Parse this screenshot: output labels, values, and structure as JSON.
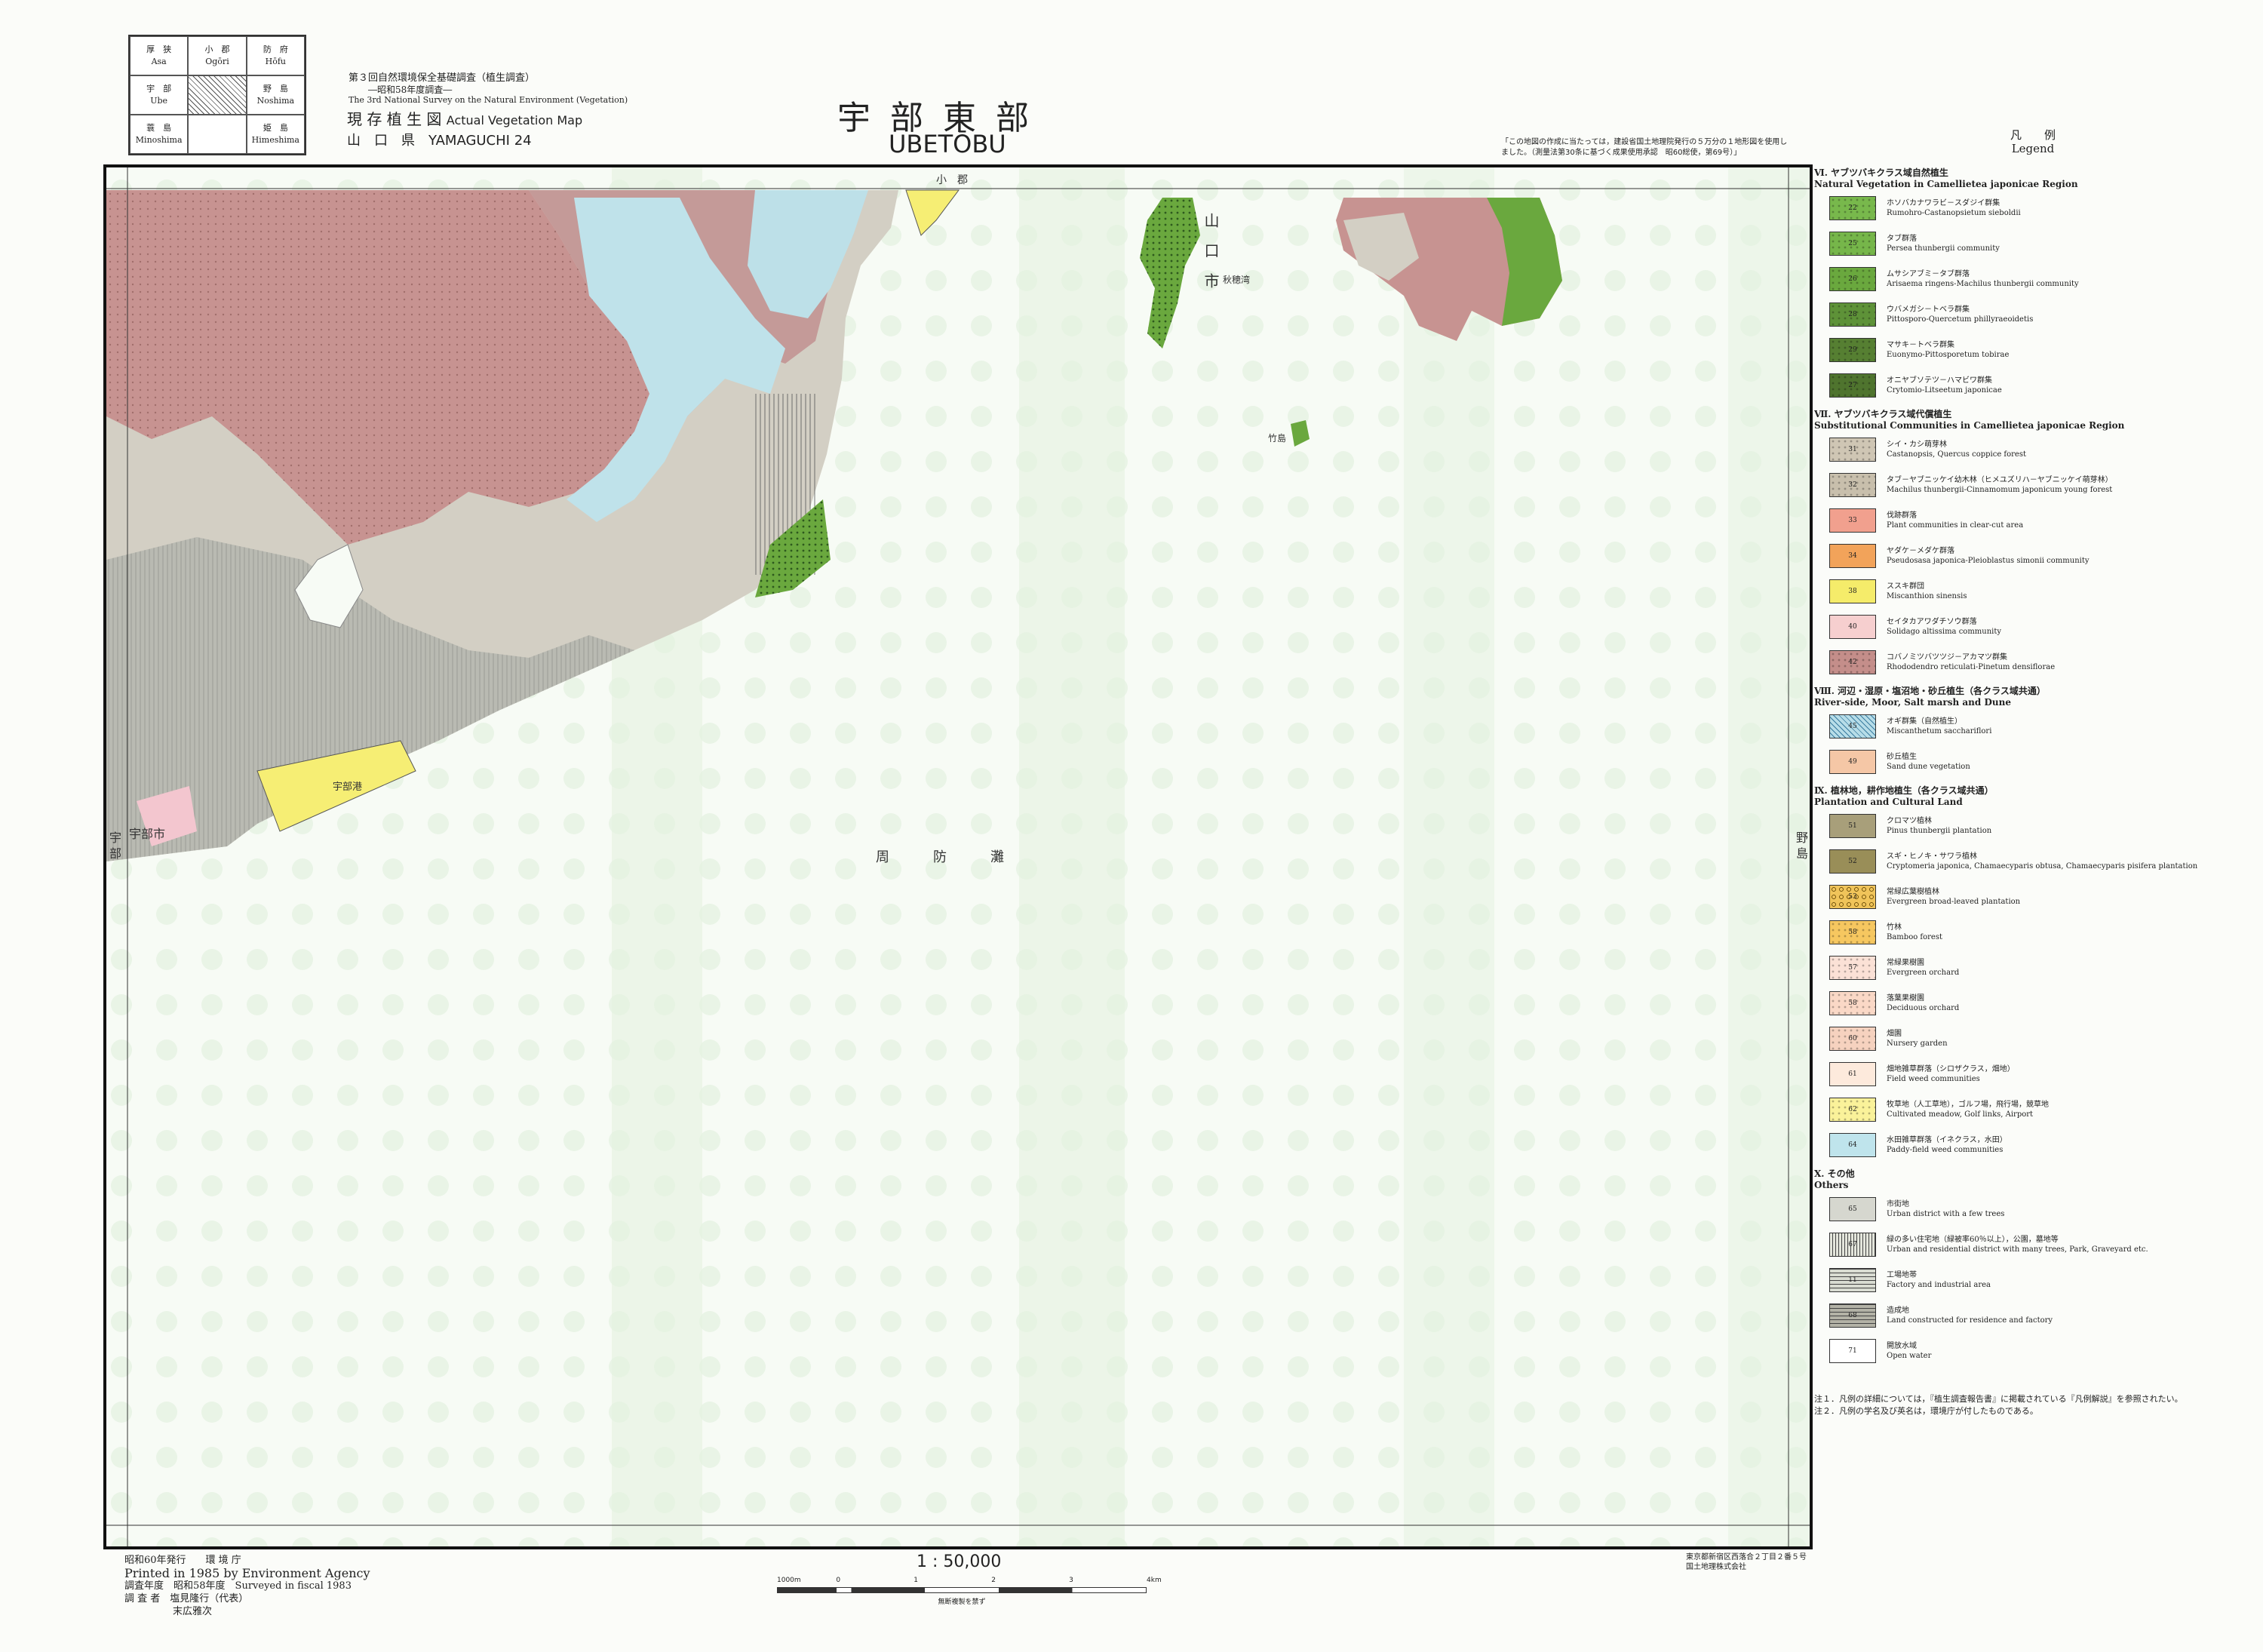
{
  "index_map": [
    {
      "ja": "厚　狭",
      "en": "Asa"
    },
    {
      "ja": "小　郡",
      "en": "Ogōri"
    },
    {
      "ja": "防　府",
      "en": "Hōfu"
    },
    {
      "ja": "宇　部",
      "en": "Ube"
    },
    {
      "ja": "",
      "en": ""
    },
    {
      "ja": "野　島",
      "en": "Noshima"
    },
    {
      "ja": "蓑　島",
      "en": "Minoshima"
    },
    {
      "ja": "",
      "en": ""
    },
    {
      "ja": "姫　島",
      "en": "Himeshima"
    }
  ],
  "survey": {
    "line1": "第３回自然環境保全基礎調査（植生調査）",
    "line2": "―昭和58年度調査―",
    "line3": "The 3rd National Survey on the Natural Environment (Vegetation)",
    "map_type_ja": "現 存 植 生 図",
    "map_type_en": "Actual Vegetation Map",
    "pref": "山　口　県　YAMAGUCHI 24"
  },
  "title": {
    "ja": "宇 部 東 部",
    "en": "UBETŌBU"
  },
  "top_note": "「この地図の作成に当たっては，建設省国土地理院発行の５万分の１地形図を使用しました。（測量法第30条に基づく成果使用承認　昭60総使，第69号）」",
  "map_labels": {
    "ogori": "小　郡",
    "yamaguchi": "山　口　市",
    "ube_city": "宇部市",
    "ube_v": "宇 部",
    "noshima_v": "野 島",
    "suonada": "周　防　灘",
    "takeshima": "竹島",
    "port": "宇部港",
    "aio": "秋穂湾"
  },
  "legend": {
    "title_ja": "凡　　例",
    "title_en": "Legend",
    "sections": [
      {
        "heading": "Ⅵ. ヤブツバキクラス域自然植生\nNatural Vegetation in Camellietea japonicae Region",
        "items": [
          {
            "code": "22",
            "ja": "ホソバカナワラビ－スダジイ群集",
            "en": "Rumohro-Castanopsietum sieboldii",
            "color": "#78b84c",
            "pattern": "dots"
          },
          {
            "code": "25",
            "ja": "タブ群落",
            "en": "Persea thunbergii community",
            "color": "#76b64a",
            "pattern": "dots"
          },
          {
            "code": "26",
            "ja": "ムサシアブミ－タブ群落",
            "en": "Arisaema ringens-Machilus thunbergii community",
            "color": "#6aa83e",
            "pattern": "dots"
          },
          {
            "code": "28",
            "ja": "ウバメガシ－トベラ群集",
            "en": "Pittosporo-Quercetum phillyraeoidetis",
            "color": "#5e9238",
            "pattern": "dots"
          },
          {
            "code": "29",
            "ja": "マサキ－トベラ群集",
            "en": "Euonymo-Pittosporetum tobirae",
            "color": "#567f32",
            "pattern": "dots"
          },
          {
            "code": "27",
            "ja": "オニヤブソテツ－ハマビワ群集",
            "en": "Crytomio-Litseetum japonicae",
            "color": "#4f742e",
            "pattern": "dots"
          }
        ]
      },
      {
        "heading": "Ⅶ. ヤブツバキクラス域代償植生\nSubstitutional Communities in Camellietea japonicae Region",
        "items": [
          {
            "code": "31",
            "ja": "シイ・カシ萌芽林",
            "en": "Castanopsis, Quercus coppice forest",
            "color": "#cfc6b4",
            "pattern": "dots"
          },
          {
            "code": "32",
            "ja": "タブ－ヤブニッケイ幼木林（ヒメユズリハ－ヤブニッケイ萌芽林）",
            "en": "Machilus thunbergii-Cinnamomum japonicum young forest",
            "color": "#c8bfac",
            "pattern": "dots"
          },
          {
            "code": "33",
            "ja": "伐跡群落",
            "en": "Plant communities in clear-cut area",
            "color": "#f1a08e",
            "pattern": "none"
          },
          {
            "code": "34",
            "ja": "ヤダケ－メダケ群落",
            "en": "Pseudosasa japonica-Pleioblastus simonii community",
            "color": "#f2a35a",
            "pattern": "none"
          },
          {
            "code": "38",
            "ja": "ススキ群団",
            "en": "Miscanthion sinensis",
            "color": "#f5ec6a",
            "pattern": "none"
          },
          {
            "code": "40",
            "ja": "セイタカアワダチソウ群落",
            "en": "Solidago altissima community",
            "color": "#f6cfcf",
            "pattern": "none"
          },
          {
            "code": "42",
            "ja": "コバノミツバツツジ－アカマツ群集",
            "en": "Rhododendro reticulati-Pinetum densiflorae",
            "color": "#c48e8a",
            "pattern": "dots"
          }
        ]
      },
      {
        "heading": "Ⅷ. 河辺・湿原・塩沼地・砂丘植生（各クラス域共通）\nRiver-side, Moor, Salt marsh and Dune",
        "items": [
          {
            "code": "45",
            "ja": "オギ群集（自然植生）",
            "en": "Miscanthetum sacchariflori",
            "color": "#b7dde8",
            "pattern": "hatch"
          },
          {
            "code": "49",
            "ja": "砂丘植生",
            "en": "Sand dune vegetation",
            "color": "#f5c7a6",
            "pattern": "none"
          }
        ]
      },
      {
        "heading": "Ⅸ. 植林地，耕作地植生（各クラス域共通）\nPlantation and Cultural Land",
        "items": [
          {
            "code": "51",
            "ja": "クロマツ植林",
            "en": "Pinus thunbergii plantation",
            "color": "#a89f7a",
            "pattern": "none"
          },
          {
            "code": "52",
            "ja": "スギ・ヒノキ・サワラ植林",
            "en": "Cryptomeria japonica, Chamaecyparis obtusa, Chamaecyparis pisifera plantation",
            "color": "#998e58",
            "pattern": "none"
          },
          {
            "code": "53",
            "ja": "常緑広葉樹植林",
            "en": "Evergreen broad-leaved plantation",
            "color": "#f0c45a",
            "pattern": "rings"
          },
          {
            "code": "58",
            "ja": "竹林",
            "en": "Bamboo forest",
            "color": "#f6c760",
            "pattern": "dots"
          },
          {
            "code": "57",
            "ja": "常緑果樹園",
            "en": "Evergreen orchard",
            "color": "#fbe1d6",
            "pattern": "dots"
          },
          {
            "code": "58",
            "ja": "落葉果樹園",
            "en": "Deciduous orchard",
            "color": "#fad8c6",
            "pattern": "dots"
          },
          {
            "code": "60",
            "ja": "畑園",
            "en": "Nursery garden",
            "color": "#f6d2bf",
            "pattern": "dots"
          },
          {
            "code": "61",
            "ja": "畑地雑草群落（シロザクラス，畑地）",
            "en": "Field weed communities",
            "color": "#fdeadc",
            "pattern": "none"
          },
          {
            "code": "62",
            "ja": "牧草地（人工草地），ゴルフ場，飛行場，競草地",
            "en": "Cultivated meadow, Golf links, Airport",
            "color": "#faf29a",
            "pattern": "dots"
          },
          {
            "code": "64",
            "ja": "水田雑草群落（イネクラス，水田）",
            "en": "Paddy-field weed communities",
            "color": "#bfe4ec",
            "pattern": "none"
          }
        ]
      },
      {
        "heading": "Ⅹ. その他\nOthers",
        "items": [
          {
            "code": "65",
            "ja": "市街地",
            "en": "Urban district with a few trees",
            "color": "#d6d7cf",
            "pattern": "none"
          },
          {
            "code": "67",
            "ja": "緑の多い住宅地（緑被率60％以上），公園，墓地等",
            "en": "Urban and residential district with many trees, Park, Graveyard etc.",
            "color": "#e4e6dc",
            "pattern": "vlines"
          },
          {
            "code": "11",
            "ja": "工場地帯",
            "en": "Factory and industrial area",
            "color": "#d9dcd2",
            "pattern": "hlines"
          },
          {
            "code": "68",
            "ja": "造成地",
            "en": "Land constructed for residence and factory",
            "color": "#b3b2a6",
            "pattern": "hlines"
          },
          {
            "code": "71",
            "ja": "開放水域",
            "en": "Open water",
            "color": "#ffffff",
            "pattern": "none"
          }
        ]
      }
    ],
    "notes": [
      "注１．凡例の詳細については，『植生調査報告書』に掲載されている『凡例解説』を参照されたい。",
      "注２．凡例の学名及び英名は，環境庁が付したものである。"
    ]
  },
  "bottom": {
    "issue_ja": "昭和60年発行　　環 境 庁",
    "printed": "Printed in 1985 by Environment Agency",
    "year": "調査年度　昭和58年度　Surveyed in fiscal 1983",
    "surveyor": "調 査 者　塩見隆行（代表）",
    "surveyor2": "末広雅次",
    "scale": "1 : 50,000",
    "scale_note": "無断複製を禁ず",
    "scale_marks": [
      "1000m",
      "0",
      "1",
      "2",
      "3",
      "4km"
    ],
    "publisher_addr": "東京都新宿区西落合２丁目２番５号",
    "publisher": "国土地理株式会社"
  }
}
